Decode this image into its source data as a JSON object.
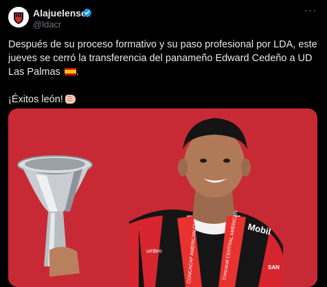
{
  "account": {
    "name": "Alajuelense",
    "handle": "@ldacr",
    "verified_color": "#1d9bf0"
  },
  "menu": {
    "more_label": "···",
    "icon": "more-icon"
  },
  "tweet": {
    "paragraph1": "Después de su proceso formativo y su paso profesional por LDA, este jueves se cerró la transferencia del panameño Edward Cedeño a UD Las Palmas",
    "paragraph1_emoji": "spain-flag-icon",
    "paragraph1_end": ".",
    "paragraph2": "¡Éxitos león!",
    "paragraph2_emoji": "fist-bump-icon"
  },
  "media": {
    "background_color": "#c82a35",
    "jersey_sponsor": "Mobil",
    "jersey_brand": "umbro",
    "medal_ribbon_left": "CONCACAF AMERICAN CUP",
    "medal_ribbon_right": "Concacaf CENTRAL AMERICAN",
    "sleeve_text": "SAN"
  }
}
